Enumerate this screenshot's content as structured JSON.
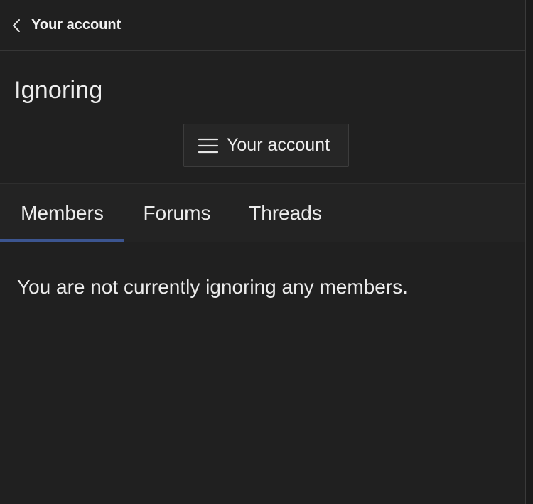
{
  "header": {
    "back_label": "Your account"
  },
  "page": {
    "title": "Ignoring"
  },
  "account_menu": {
    "label": "Your account"
  },
  "tabs": [
    {
      "label": "Members",
      "active": true
    },
    {
      "label": "Forums",
      "active": false
    },
    {
      "label": "Threads",
      "active": false
    }
  ],
  "content": {
    "empty_message": "You are not currently ignoring any members."
  },
  "colors": {
    "background": "#202020",
    "active_tab_indicator": "#3c5590",
    "text": "#ececec"
  },
  "icons": {
    "back": "chevron-left-icon",
    "menu": "hamburger-menu-icon"
  }
}
